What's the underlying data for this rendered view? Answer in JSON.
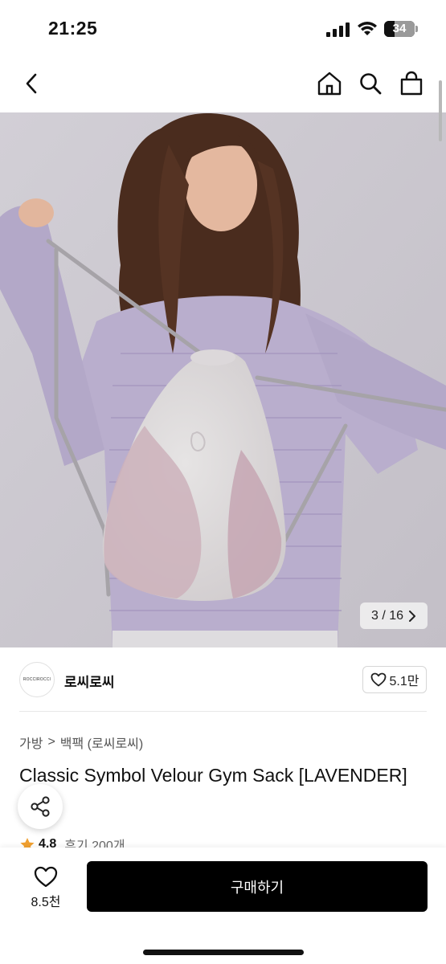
{
  "status_bar": {
    "time": "21:25",
    "battery_text": "34",
    "battery_level": 0.34
  },
  "nav": {
    "back_icon": "chevron-left-icon",
    "home_icon": "home-icon",
    "search_icon": "search-icon",
    "cart_icon": "shopping-bag-icon"
  },
  "gallery": {
    "counter": "3 / 16",
    "next_icon": "chevron-right-icon"
  },
  "seller": {
    "logo_text": "ROCCIROCCI",
    "name": "로씨로씨",
    "like_count": "5.1만"
  },
  "breadcrumb": {
    "category": "가방",
    "separator": ">",
    "subcategory": "백팩 (로씨로씨)"
  },
  "product": {
    "title": "Classic Symbol Velour Gym Sack [LAVENDER]",
    "rating": "4.8",
    "review_label": "후기 200개"
  },
  "bottom_bar": {
    "wish_count": "8.5천",
    "buy_label": "구매하기"
  },
  "colors": {
    "accent": "#000000",
    "star": "#f0a030",
    "background": "#ffffff"
  }
}
